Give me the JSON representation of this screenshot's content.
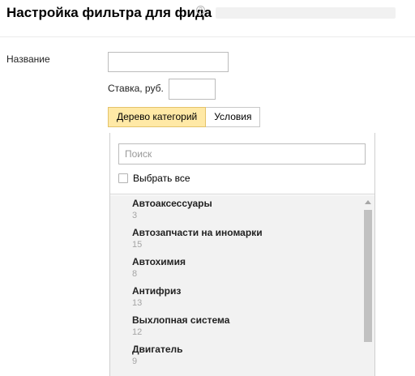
{
  "header": {
    "title": "Настройка фильтра для фида",
    "help_glyph": "?"
  },
  "form": {
    "name_label": "Название",
    "name_value": "",
    "rate_label": "Ставка, руб.",
    "rate_value": ""
  },
  "tabs": [
    {
      "label": "Дерево категорий",
      "active": true
    },
    {
      "label": "Условия",
      "active": false
    }
  ],
  "tree": {
    "search_placeholder": "Поиск",
    "select_all_label": "Выбрать все",
    "select_all_checked": false,
    "items": [
      {
        "name": "Автоаксессуары",
        "count": "3"
      },
      {
        "name": "Автозапчасти на иномарки",
        "count": "15"
      },
      {
        "name": "Автохимия",
        "count": "8"
      },
      {
        "name": "Антифриз",
        "count": "13"
      },
      {
        "name": "Выхлопная система",
        "count": "12"
      },
      {
        "name": "Двигатель",
        "count": "9"
      }
    ]
  },
  "colors": {
    "active_tab_bg": "#ffe9a6",
    "list_bg": "#f2f2f2"
  }
}
